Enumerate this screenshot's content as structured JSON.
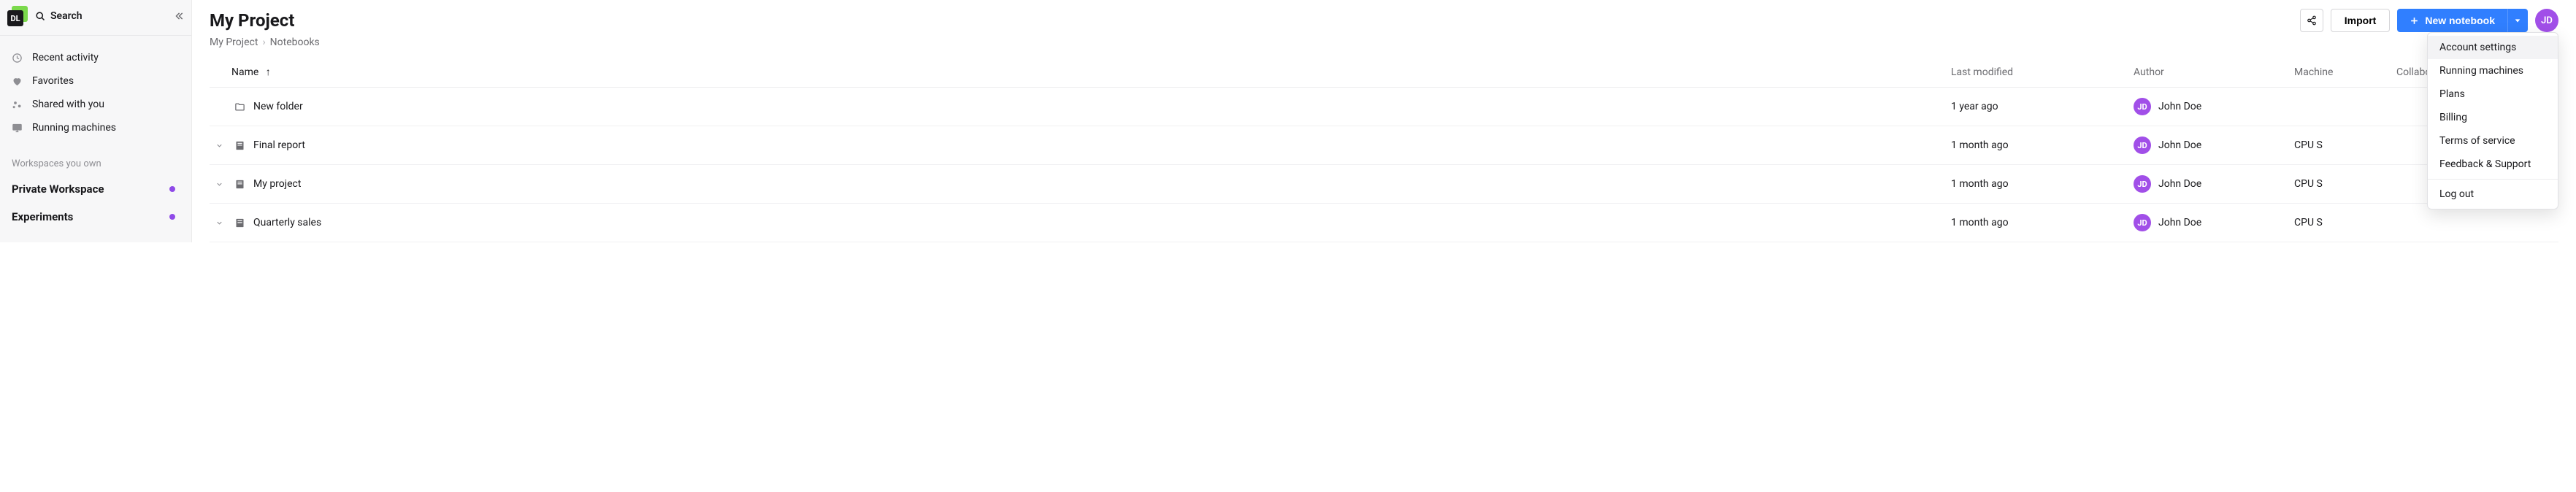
{
  "sidebar": {
    "logo_text": "DL",
    "search_label": "Search",
    "nav": [
      {
        "icon": "clock",
        "label": "Recent activity"
      },
      {
        "icon": "heart",
        "label": "Favorites"
      },
      {
        "icon": "share",
        "label": "Shared with you"
      },
      {
        "icon": "monitor",
        "label": "Running machines"
      }
    ],
    "section_label": "Workspaces you own",
    "workspaces": [
      {
        "name": "Private Workspace",
        "dot_color": "#8f4ae8"
      },
      {
        "name": "Experiments",
        "dot_color": "#8f4ae8"
      }
    ]
  },
  "header": {
    "title": "My Project",
    "breadcrumb": [
      "My Project",
      "Notebooks"
    ],
    "import_label": "Import",
    "new_notebook_label": "New notebook",
    "avatar_initials": "JD"
  },
  "table": {
    "columns": {
      "name": "Name",
      "modified": "Last modified",
      "author": "Author",
      "machine": "Machine",
      "collaborators": "Collaborators"
    },
    "rows": [
      {
        "expandable": false,
        "kind": "folder",
        "name": "New folder",
        "modified": "1 year ago",
        "author_initials": "JD",
        "author_name": "John Doe",
        "machine": "",
        "show_actions": false
      },
      {
        "expandable": true,
        "kind": "notebook",
        "name": "Final report",
        "modified": "1 month ago",
        "author_initials": "JD",
        "author_name": "John Doe",
        "machine": "CPU S",
        "show_actions": false
      },
      {
        "expandable": true,
        "kind": "notebook",
        "name": "My project",
        "modified": "1 month ago",
        "author_initials": "JD",
        "author_name": "John Doe",
        "machine": "CPU S",
        "show_actions": true
      },
      {
        "expandable": true,
        "kind": "notebook",
        "name": "Quarterly sales",
        "modified": "1 month ago",
        "author_initials": "JD",
        "author_name": "John Doe",
        "machine": "CPU S",
        "show_actions": false
      }
    ]
  },
  "dropdown": {
    "items": [
      {
        "label": "Account settings",
        "hover": true
      },
      {
        "label": "Running machines"
      },
      {
        "label": "Plans"
      },
      {
        "label": "Billing"
      },
      {
        "label": "Terms of service"
      },
      {
        "label": "Feedback & Support"
      }
    ],
    "footer_item": {
      "label": "Log out"
    }
  }
}
